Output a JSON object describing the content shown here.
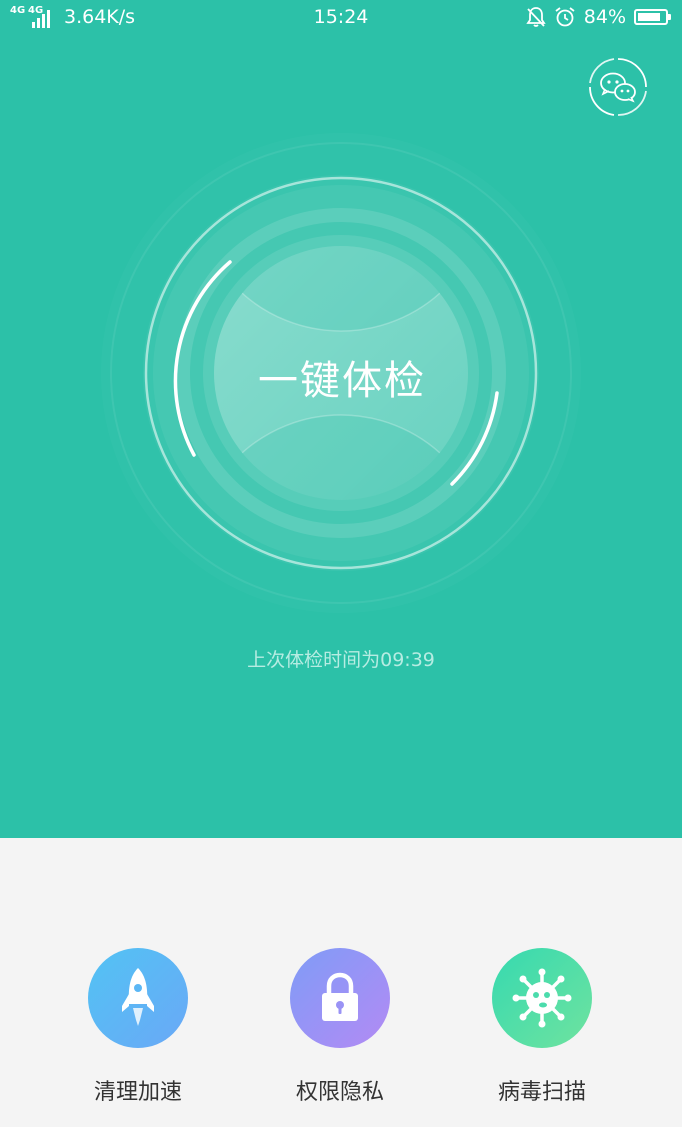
{
  "status_bar": {
    "network_type_1": "4G",
    "network_type_2": "4G",
    "speed": "3.64K/s",
    "time": "15:24",
    "battery_percent": "84%",
    "battery_level": 0.84,
    "icons": [
      "signal-icon",
      "mute-bell-icon",
      "alarm-icon",
      "battery-icon"
    ]
  },
  "header": {
    "wechat_icon": "wechat-clean-icon"
  },
  "main": {
    "check_button_label": "一键体检",
    "last_check_text": "上次体检时间为09:39"
  },
  "tools": [
    {
      "label": "清理加速",
      "icon": "rocket-icon",
      "colors": [
        "#52c3f4",
        "#6aa8f6"
      ]
    },
    {
      "label": "权限隐私",
      "icon": "lock-icon",
      "colors": [
        "#7f9cf7",
        "#b38af4"
      ]
    },
    {
      "label": "病毒扫描",
      "icon": "virus-icon",
      "colors": [
        "#36d9b0",
        "#6fe39f"
      ]
    }
  ],
  "colors": {
    "primary": "#2cc1a8",
    "background": "#f4f4f4",
    "text": "#333333",
    "subtext": "#b6ece2"
  }
}
